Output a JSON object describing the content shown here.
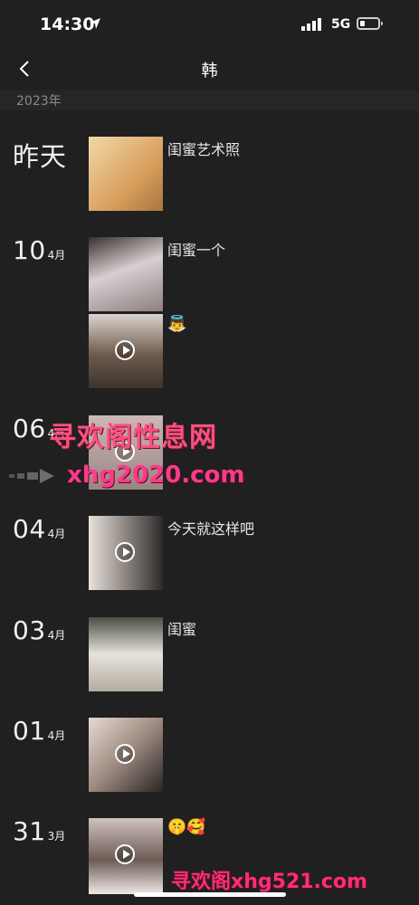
{
  "status": {
    "time": "14:30",
    "network": "5G",
    "battery_level": 0.3
  },
  "nav": {
    "title": "韩"
  },
  "year": "2023年",
  "entries": [
    {
      "date_word": "昨天",
      "date_day": "",
      "date_month": "",
      "posts": [
        {
          "caption": "闺蜜艺术照",
          "video": false
        }
      ]
    },
    {
      "date_word": "",
      "date_day": "10",
      "date_month": "4月",
      "posts": [
        {
          "caption": "闺蜜一个",
          "video": false
        },
        {
          "caption": "👼",
          "video": true
        }
      ]
    },
    {
      "date_word": "",
      "date_day": "06",
      "date_month": "4月",
      "posts": [
        {
          "caption": "",
          "video": true
        }
      ]
    },
    {
      "date_word": "",
      "date_day": "04",
      "date_month": "4月",
      "posts": [
        {
          "caption": "今天就这样吧",
          "video": true
        }
      ]
    },
    {
      "date_word": "",
      "date_day": "03",
      "date_month": "4月",
      "posts": [
        {
          "caption": "闺蜜",
          "video": false
        }
      ]
    },
    {
      "date_word": "",
      "date_day": "01",
      "date_month": "4月",
      "posts": [
        {
          "caption": "",
          "video": true
        }
      ]
    },
    {
      "date_word": "",
      "date_day": "31",
      "date_month": "3月",
      "posts": [
        {
          "caption": "🤫🥰",
          "video": true
        }
      ]
    }
  ],
  "watermarks": {
    "line1": "寻欢阁性息网",
    "line2": "xhg2020.com",
    "line3": "寻欢阁xhg521.com"
  },
  "colors": {
    "background": "#202020",
    "watermark": "#ff3a8a"
  }
}
